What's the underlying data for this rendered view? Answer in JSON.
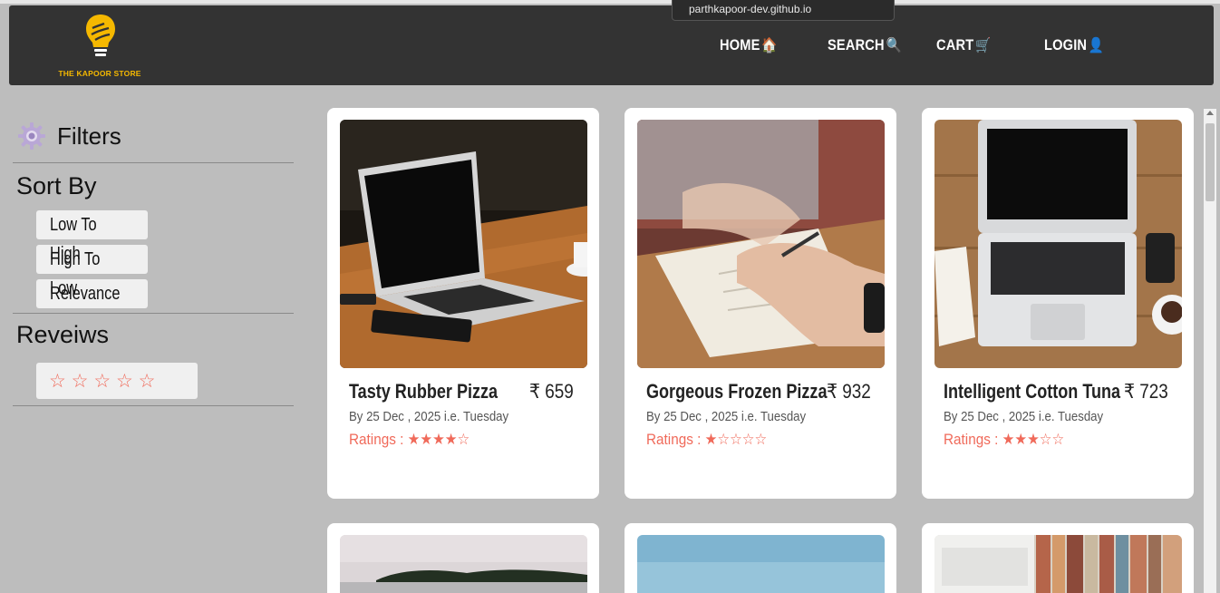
{
  "browser": {
    "url_tooltip": "parthkapoor-dev.github.io"
  },
  "brand": {
    "logo_text": "THE KAPOOR STORE",
    "accent": "#f5b800"
  },
  "nav": {
    "items": [
      {
        "label": "HOME",
        "emoji": "🏠"
      },
      {
        "label": "SEARCH",
        "emoji": "🔍"
      },
      {
        "label": "CART",
        "emoji": "🛒"
      },
      {
        "label": "LOGIN",
        "emoji": "👤"
      }
    ]
  },
  "sidebar": {
    "filters_title": "Filters",
    "sort_title": "Sort By",
    "sort_options": [
      "Low To High",
      "High To Low",
      "Relevance"
    ],
    "reviews_title": "Reveiws",
    "review_stars": "☆ ☆ ☆ ☆ ☆"
  },
  "products": [
    {
      "name": "Tasty Rubber Pizza",
      "price": "₹ 659",
      "delivery": "By 25 Dec , 2025 i.e. Tuesday",
      "ratings_label": "Ratings : ",
      "stars": "★★★★☆",
      "rating": 4
    },
    {
      "name": "Gorgeous Frozen Pizza",
      "price": "₹ 932",
      "delivery": "By 25 Dec , 2025 i.e. Tuesday",
      "ratings_label": "Ratings : ",
      "stars": "★☆☆☆☆",
      "rating": 1
    },
    {
      "name": "Intelligent Cotton Tuna",
      "price": "₹ 723",
      "delivery": "By 25 Dec , 2025 i.e. Tuesday",
      "ratings_label": "Ratings : ",
      "stars": "★★★☆☆",
      "rating": 3
    }
  ],
  "colors": {
    "navbar": "#333333",
    "page_bg": "#bdbdbd",
    "rating": "#f06a5a"
  }
}
